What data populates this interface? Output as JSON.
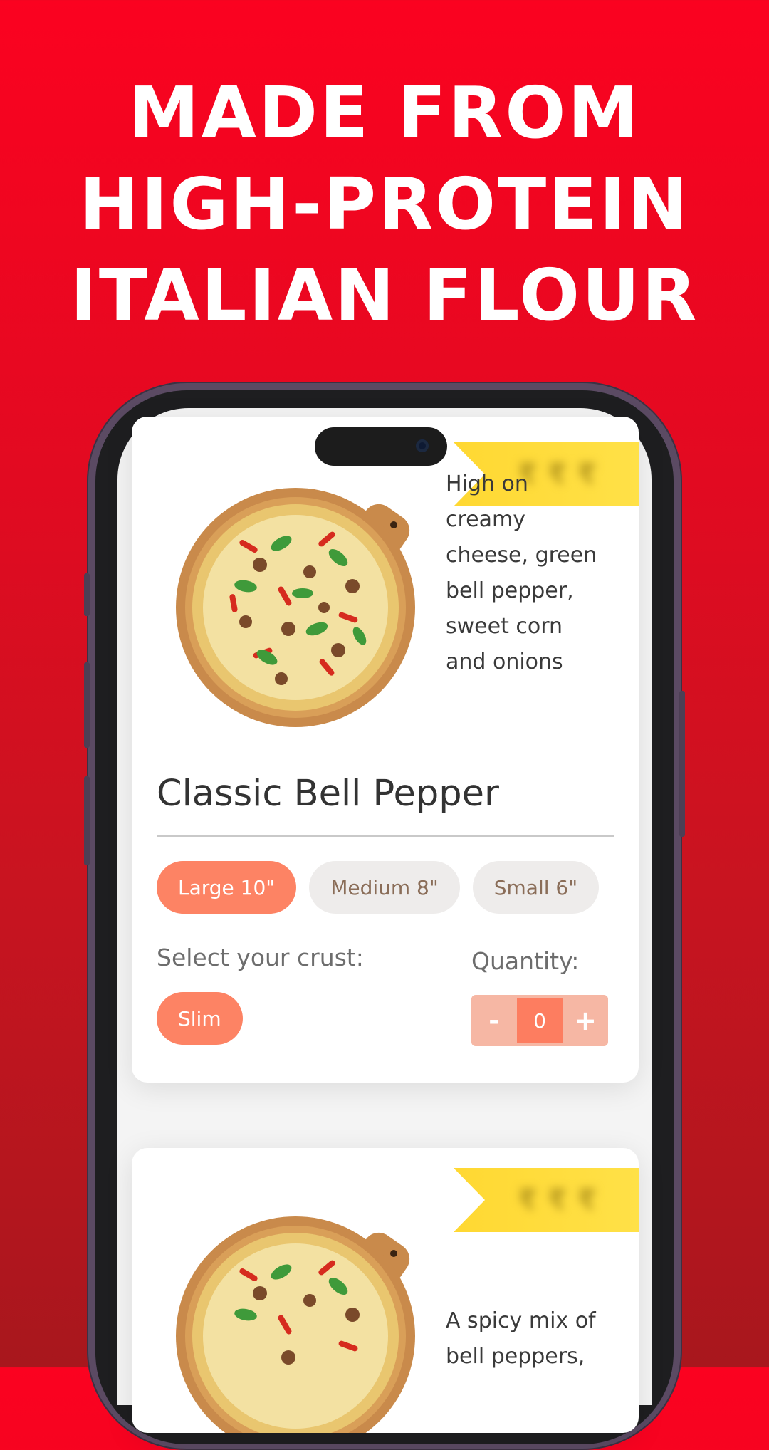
{
  "headline": {
    "line1": "MADE FROM",
    "line2": "HIGH-PROTEIN",
    "line3": "ITALIAN FLOUR"
  },
  "colors": {
    "background": "#e00a22",
    "accent": "#fd8364",
    "ribbon": "#ffd832"
  },
  "products": [
    {
      "name": "Classic Bell Pepper",
      "description_lines": [
        "High on",
        "creamy",
        "cheese, green",
        "bell pepper,",
        "sweet corn",
        "and onions"
      ],
      "sizes": [
        "Large 10\"",
        "Medium 8\"",
        "Small 6\""
      ],
      "selected_size": "Large 10\"",
      "crust_label": "Select your crust:",
      "crust_option": "Slim",
      "quantity_label": "Quantity:",
      "quantity": "0",
      "minus": "-",
      "plus": "+"
    },
    {
      "description_lines": [
        "A spicy mix of",
        "bell peppers,"
      ]
    }
  ],
  "icons": [
    "pizza-image",
    "camera-icon",
    "price-ribbon"
  ]
}
